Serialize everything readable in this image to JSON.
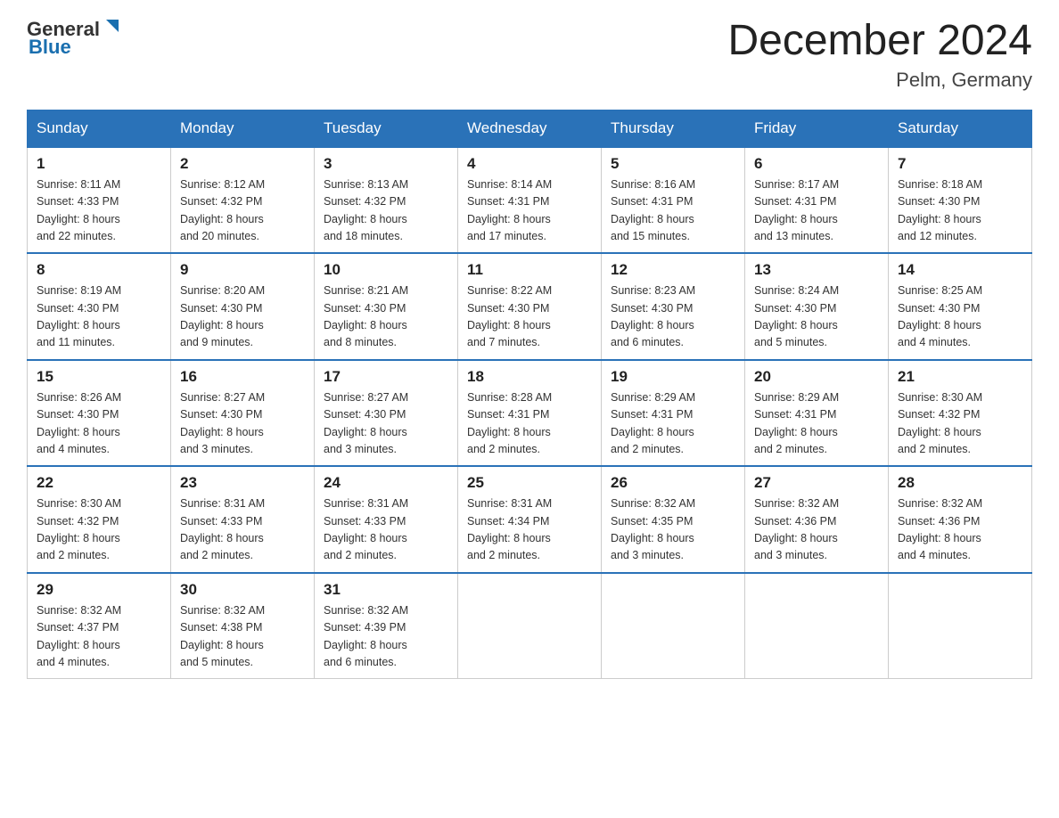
{
  "header": {
    "logo_general": "General",
    "logo_blue": "Blue",
    "title": "December 2024",
    "subtitle": "Pelm, Germany"
  },
  "days_of_week": [
    "Sunday",
    "Monday",
    "Tuesday",
    "Wednesday",
    "Thursday",
    "Friday",
    "Saturday"
  ],
  "weeks": [
    [
      {
        "day": "1",
        "sunrise": "8:11 AM",
        "sunset": "4:33 PM",
        "daylight": "8 hours and 22 minutes."
      },
      {
        "day": "2",
        "sunrise": "8:12 AM",
        "sunset": "4:32 PM",
        "daylight": "8 hours and 20 minutes."
      },
      {
        "day": "3",
        "sunrise": "8:13 AM",
        "sunset": "4:32 PM",
        "daylight": "8 hours and 18 minutes."
      },
      {
        "day": "4",
        "sunrise": "8:14 AM",
        "sunset": "4:31 PM",
        "daylight": "8 hours and 17 minutes."
      },
      {
        "day": "5",
        "sunrise": "8:16 AM",
        "sunset": "4:31 PM",
        "daylight": "8 hours and 15 minutes."
      },
      {
        "day": "6",
        "sunrise": "8:17 AM",
        "sunset": "4:31 PM",
        "daylight": "8 hours and 13 minutes."
      },
      {
        "day": "7",
        "sunrise": "8:18 AM",
        "sunset": "4:30 PM",
        "daylight": "8 hours and 12 minutes."
      }
    ],
    [
      {
        "day": "8",
        "sunrise": "8:19 AM",
        "sunset": "4:30 PM",
        "daylight": "8 hours and 11 minutes."
      },
      {
        "day": "9",
        "sunrise": "8:20 AM",
        "sunset": "4:30 PM",
        "daylight": "8 hours and 9 minutes."
      },
      {
        "day": "10",
        "sunrise": "8:21 AM",
        "sunset": "4:30 PM",
        "daylight": "8 hours and 8 minutes."
      },
      {
        "day": "11",
        "sunrise": "8:22 AM",
        "sunset": "4:30 PM",
        "daylight": "8 hours and 7 minutes."
      },
      {
        "day": "12",
        "sunrise": "8:23 AM",
        "sunset": "4:30 PM",
        "daylight": "8 hours and 6 minutes."
      },
      {
        "day": "13",
        "sunrise": "8:24 AM",
        "sunset": "4:30 PM",
        "daylight": "8 hours and 5 minutes."
      },
      {
        "day": "14",
        "sunrise": "8:25 AM",
        "sunset": "4:30 PM",
        "daylight": "8 hours and 4 minutes."
      }
    ],
    [
      {
        "day": "15",
        "sunrise": "8:26 AM",
        "sunset": "4:30 PM",
        "daylight": "8 hours and 4 minutes."
      },
      {
        "day": "16",
        "sunrise": "8:27 AM",
        "sunset": "4:30 PM",
        "daylight": "8 hours and 3 minutes."
      },
      {
        "day": "17",
        "sunrise": "8:27 AM",
        "sunset": "4:30 PM",
        "daylight": "8 hours and 3 minutes."
      },
      {
        "day": "18",
        "sunrise": "8:28 AM",
        "sunset": "4:31 PM",
        "daylight": "8 hours and 2 minutes."
      },
      {
        "day": "19",
        "sunrise": "8:29 AM",
        "sunset": "4:31 PM",
        "daylight": "8 hours and 2 minutes."
      },
      {
        "day": "20",
        "sunrise": "8:29 AM",
        "sunset": "4:31 PM",
        "daylight": "8 hours and 2 minutes."
      },
      {
        "day": "21",
        "sunrise": "8:30 AM",
        "sunset": "4:32 PM",
        "daylight": "8 hours and 2 minutes."
      }
    ],
    [
      {
        "day": "22",
        "sunrise": "8:30 AM",
        "sunset": "4:32 PM",
        "daylight": "8 hours and 2 minutes."
      },
      {
        "day": "23",
        "sunrise": "8:31 AM",
        "sunset": "4:33 PM",
        "daylight": "8 hours and 2 minutes."
      },
      {
        "day": "24",
        "sunrise": "8:31 AM",
        "sunset": "4:33 PM",
        "daylight": "8 hours and 2 minutes."
      },
      {
        "day": "25",
        "sunrise": "8:31 AM",
        "sunset": "4:34 PM",
        "daylight": "8 hours and 2 minutes."
      },
      {
        "day": "26",
        "sunrise": "8:32 AM",
        "sunset": "4:35 PM",
        "daylight": "8 hours and 3 minutes."
      },
      {
        "day": "27",
        "sunrise": "8:32 AM",
        "sunset": "4:36 PM",
        "daylight": "8 hours and 3 minutes."
      },
      {
        "day": "28",
        "sunrise": "8:32 AM",
        "sunset": "4:36 PM",
        "daylight": "8 hours and 4 minutes."
      }
    ],
    [
      {
        "day": "29",
        "sunrise": "8:32 AM",
        "sunset": "4:37 PM",
        "daylight": "8 hours and 4 minutes."
      },
      {
        "day": "30",
        "sunrise": "8:32 AM",
        "sunset": "4:38 PM",
        "daylight": "8 hours and 5 minutes."
      },
      {
        "day": "31",
        "sunrise": "8:32 AM",
        "sunset": "4:39 PM",
        "daylight": "8 hours and 6 minutes."
      },
      null,
      null,
      null,
      null
    ]
  ],
  "labels": {
    "sunrise": "Sunrise:",
    "sunset": "Sunset:",
    "daylight": "Daylight:"
  }
}
